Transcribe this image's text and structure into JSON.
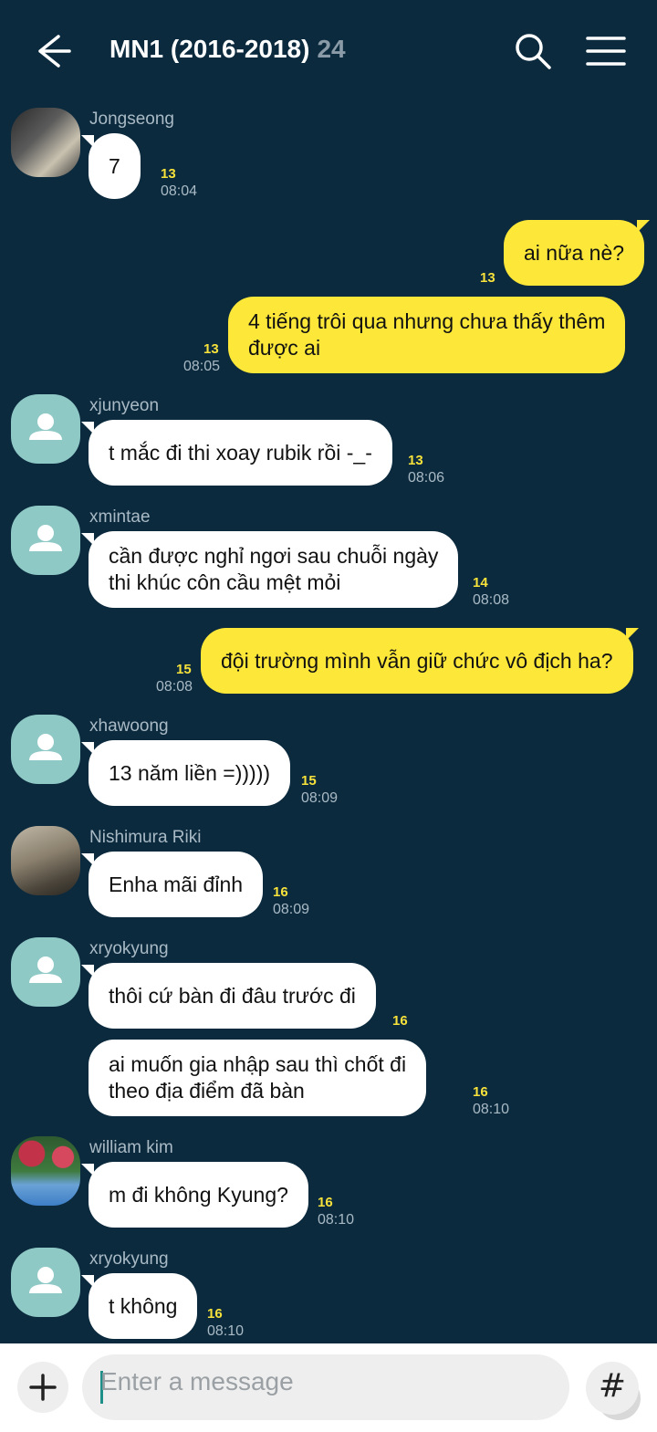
{
  "header": {
    "back_icon": "arrow-left-icon",
    "title": "MN1 (2016-2018)",
    "member_count": "24",
    "search_icon": "search-icon",
    "menu_icon": "menu-icon"
  },
  "messages": [
    {
      "sender": "Jongseong",
      "text": "7",
      "unread": "13",
      "time": "08:04",
      "direction": "in",
      "avatar": "photo"
    },
    {
      "text": "ai nữa nè?",
      "unread": "13",
      "time": "",
      "direction": "out"
    },
    {
      "text_lines": [
        "4 tiếng trôi qua nhưng chưa thấy thêm",
        "được ai"
      ],
      "unread": "13",
      "time": "08:05",
      "direction": "out"
    },
    {
      "sender": "xjunyeon",
      "text": "t mắc đi thi xoay rubik rồi -_-",
      "unread": "13",
      "time": "08:06",
      "direction": "in",
      "avatar": "default"
    },
    {
      "sender": "xmintae",
      "text_lines": [
        "cần được nghỉ ngơi sau chuỗi ngày",
        "thi khúc côn cầu mệt mỏi"
      ],
      "unread": "14",
      "time": "08:08",
      "direction": "in",
      "avatar": "default"
    },
    {
      "text": "đội trường mình vẫn giữ chức vô địch ha?",
      "unread": "15",
      "time": "08:08",
      "direction": "out"
    },
    {
      "sender": "xhawoong",
      "text": "13 năm liền =)))))",
      "unread": "15",
      "time": "08:09",
      "direction": "in",
      "avatar": "default"
    },
    {
      "sender": "Nishimura Riki",
      "text": "Enha mãi đỉnh",
      "unread": "16",
      "time": "08:09",
      "direction": "in",
      "avatar": "photo"
    },
    {
      "sender": "xryokyung",
      "text": "thôi cứ bàn đi đâu trước đi",
      "unread": "16",
      "time": "",
      "direction": "in",
      "avatar": "default"
    },
    {
      "text_lines": [
        "ai muốn gia nhập sau thì chốt đi",
        "theo địa điểm đã bàn"
      ],
      "unread": "16",
      "time": "08:10",
      "direction": "in"
    },
    {
      "sender": "william kim",
      "text": "m đi không Kyung?",
      "unread": "16",
      "time": "08:10",
      "direction": "in",
      "avatar": "photo"
    },
    {
      "sender": "xryokyung",
      "text": "t không",
      "unread": "16",
      "time": "08:10",
      "direction": "in",
      "avatar": "default"
    }
  ],
  "input": {
    "placeholder": "Enter a message",
    "plus_icon": "plus-icon",
    "emoji_icon": "emoji-icon",
    "hash_label": "#"
  },
  "colors": {
    "background": "#0b2a3e",
    "outgoing_bubble": "#fde83a",
    "incoming_bubble": "#ffffff",
    "unread_count": "#f7e13b",
    "default_avatar": "#8fc9c6"
  }
}
